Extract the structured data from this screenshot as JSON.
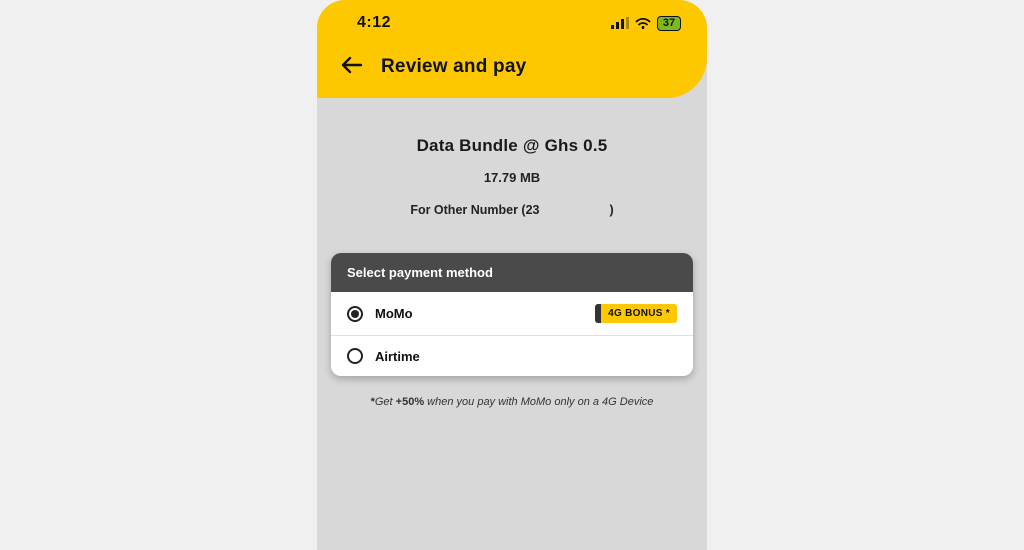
{
  "status": {
    "time": "4:12",
    "battery": "37"
  },
  "header": {
    "title": "Review and pay"
  },
  "summary": {
    "bundle_title": "Data  Bundle @ Ghs 0.5",
    "amount": "17.79 MB",
    "recipient_prefix": "For Other Number (23",
    "recipient_suffix": ")"
  },
  "payment": {
    "card_title": "Select payment method",
    "options": [
      {
        "label": "MoMo",
        "selected": true,
        "bonus": "4G BONUS *"
      },
      {
        "label": "Airtime",
        "selected": false
      }
    ]
  },
  "footnote": {
    "star": "*",
    "lead": "Get ",
    "bold": "+50%",
    "tail": " when you pay with MoMo only on a 4G Device"
  }
}
